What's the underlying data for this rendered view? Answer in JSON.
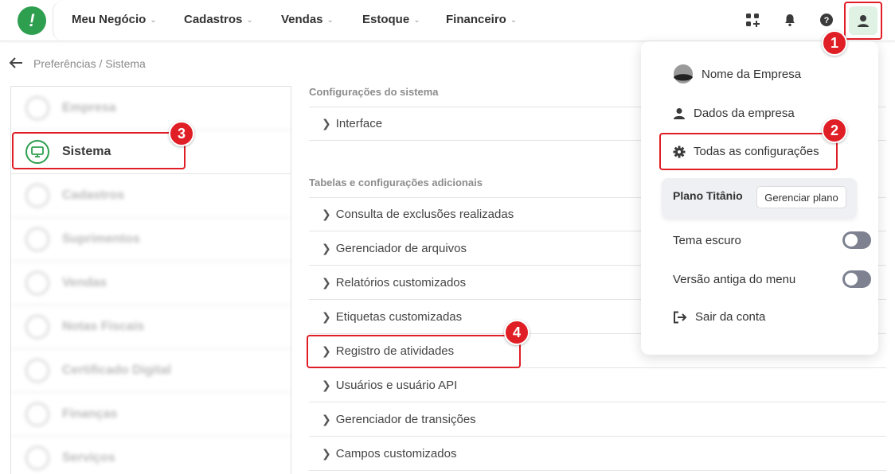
{
  "nav": {
    "items": [
      "Meu Negócio",
      "Cadastros",
      "Vendas",
      "Estoque",
      "Financeiro"
    ]
  },
  "breadcrumb": "Preferências / Sistema",
  "sidebar": {
    "items": [
      {
        "label": "Empresa"
      },
      {
        "label": "Sistema"
      },
      {
        "label": "Cadastros"
      },
      {
        "label": "Suprimentos"
      },
      {
        "label": "Vendas"
      },
      {
        "label": "Notas Fiscais"
      },
      {
        "label": "Certificado Digital"
      },
      {
        "label": "Finanças"
      },
      {
        "label": "Serviços"
      }
    ]
  },
  "main": {
    "section1_title": "Configurações do sistema",
    "section1_rows": [
      "Interface"
    ],
    "section2_title": "Tabelas e configurações adicionais",
    "section2_rows": [
      "Consulta de exclusões realizadas",
      "Gerenciador de arquivos",
      "Relatórios customizados",
      "Etiquetas customizadas",
      "Registro de atividades",
      "Usuários e usuário API",
      "Gerenciador de transições",
      "Campos customizados"
    ]
  },
  "menu": {
    "company_name": "Nome da Empresa",
    "company_data": "Dados da empresa",
    "all_settings": "Todas as configurações",
    "plan_name": "Plano Titânio",
    "plan_button": "Gerenciar plano",
    "dark_theme": "Tema escuro",
    "old_menu": "Versão antiga do menu",
    "logout": "Sair da conta"
  },
  "badges": [
    "1",
    "2",
    "3",
    "4"
  ],
  "colors": {
    "brand_green": "#2e9e4f",
    "highlight_red": "#e01e26"
  }
}
